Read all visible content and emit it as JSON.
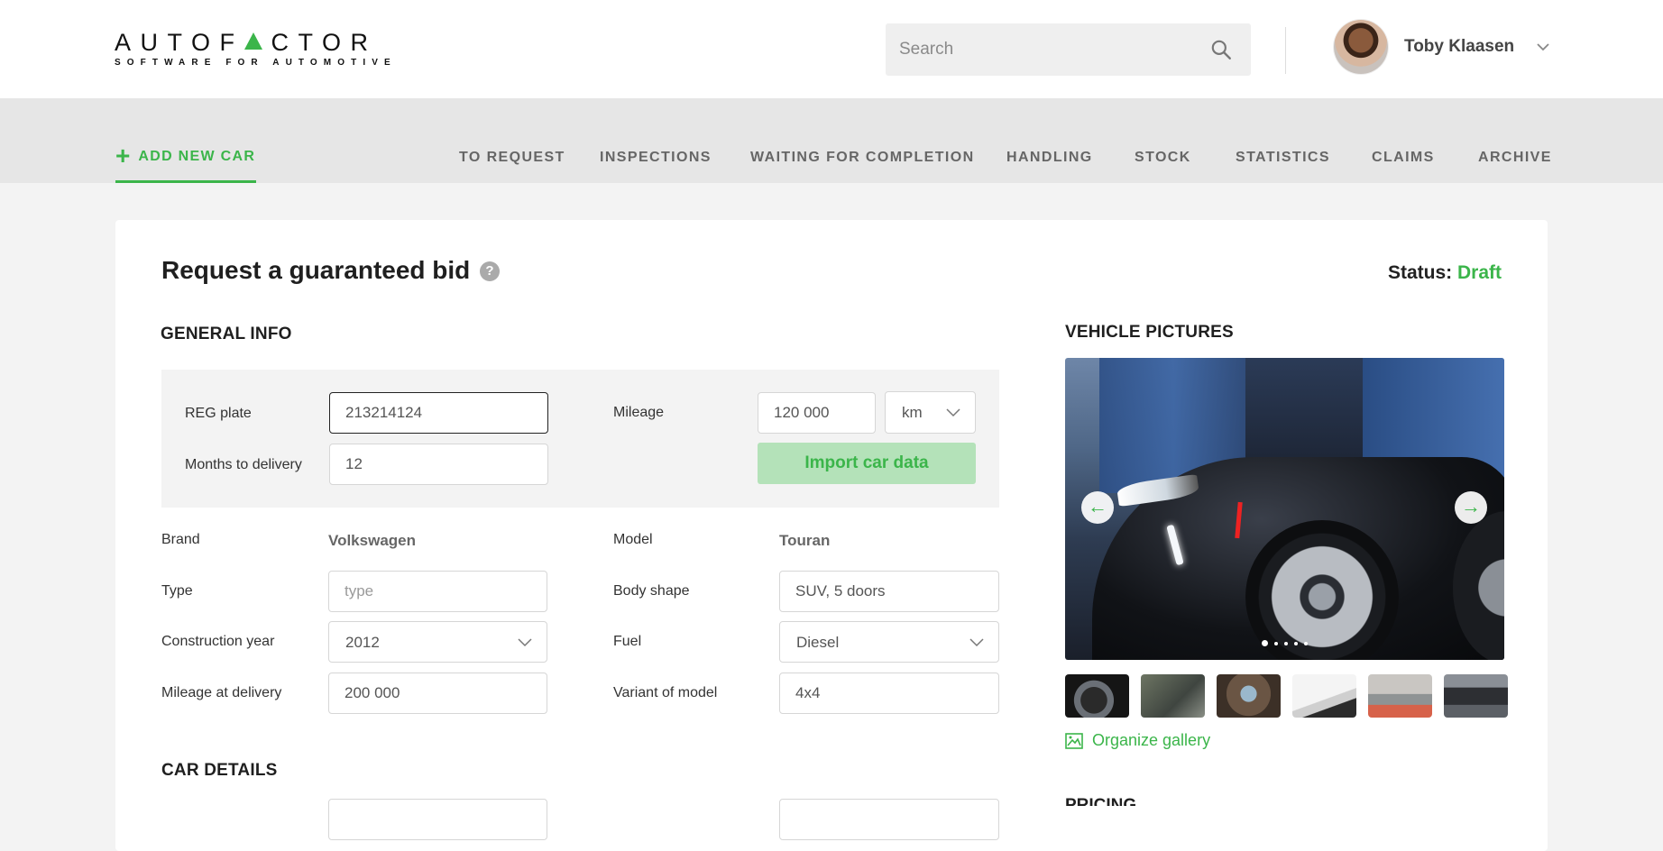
{
  "header": {
    "logo": {
      "word": "AUTOFACTOR",
      "tagline": "SOFTWARE FOR AUTOMOTIVE"
    },
    "search": {
      "placeholder": "Search",
      "value": ""
    },
    "user": {
      "name": "Toby Klaasen"
    }
  },
  "nav": {
    "add_new_car": "ADD NEW CAR",
    "tabs": [
      {
        "label": "TO REQUEST"
      },
      {
        "label": "INSPECTIONS"
      },
      {
        "label": "WAITING FOR COMPLETION"
      },
      {
        "label": "HANDLING"
      },
      {
        "label": "STOCK"
      },
      {
        "label": "STATISTICS"
      },
      {
        "label": "CLAIMS"
      },
      {
        "label": "ARCHIVE"
      }
    ]
  },
  "page": {
    "title": "Request a guaranteed bid",
    "help_glyph": "?",
    "status_label": "Status:",
    "status_value": "Draft",
    "status_color": "#3bb54a"
  },
  "general_info": {
    "heading": "GENERAL INFO",
    "reg_plate": {
      "label": "REG plate",
      "value": "213214124"
    },
    "months_to_delivery": {
      "label": "Months to delivery",
      "value": "12"
    },
    "mileage": {
      "label": "Mileage",
      "value": "120 000",
      "unit": "km"
    },
    "import_button": "Import car data",
    "brand": {
      "label": "Brand",
      "value": "Volkswagen"
    },
    "model": {
      "label": "Model",
      "value": "Touran"
    },
    "type": {
      "label": "Type",
      "placeholder": "type",
      "value": ""
    },
    "body_shape": {
      "label": "Body shape",
      "value": "SUV, 5 doors"
    },
    "construction_year": {
      "label": "Construction year",
      "value": "2012"
    },
    "fuel": {
      "label": "Fuel",
      "value": "Diesel"
    },
    "mileage_at_delivery": {
      "label": "Mileage at delivery",
      "value": "200 000"
    },
    "variant_of_model": {
      "label": "Variant of model",
      "value": "4x4"
    }
  },
  "car_details": {
    "heading": "CAR DETAILS"
  },
  "vehicle_pictures": {
    "heading": "VEHICLE PICTURES",
    "slide_count": 5,
    "active_slide": 1,
    "thumbnail_count": 6,
    "organize_gallery": "Organize gallery"
  },
  "pricing": {
    "heading": "PRICING"
  },
  "colors": {
    "accent": "#3bb54a",
    "nav_bg": "#e6e6e6",
    "page_bg": "#f3f3f3"
  }
}
